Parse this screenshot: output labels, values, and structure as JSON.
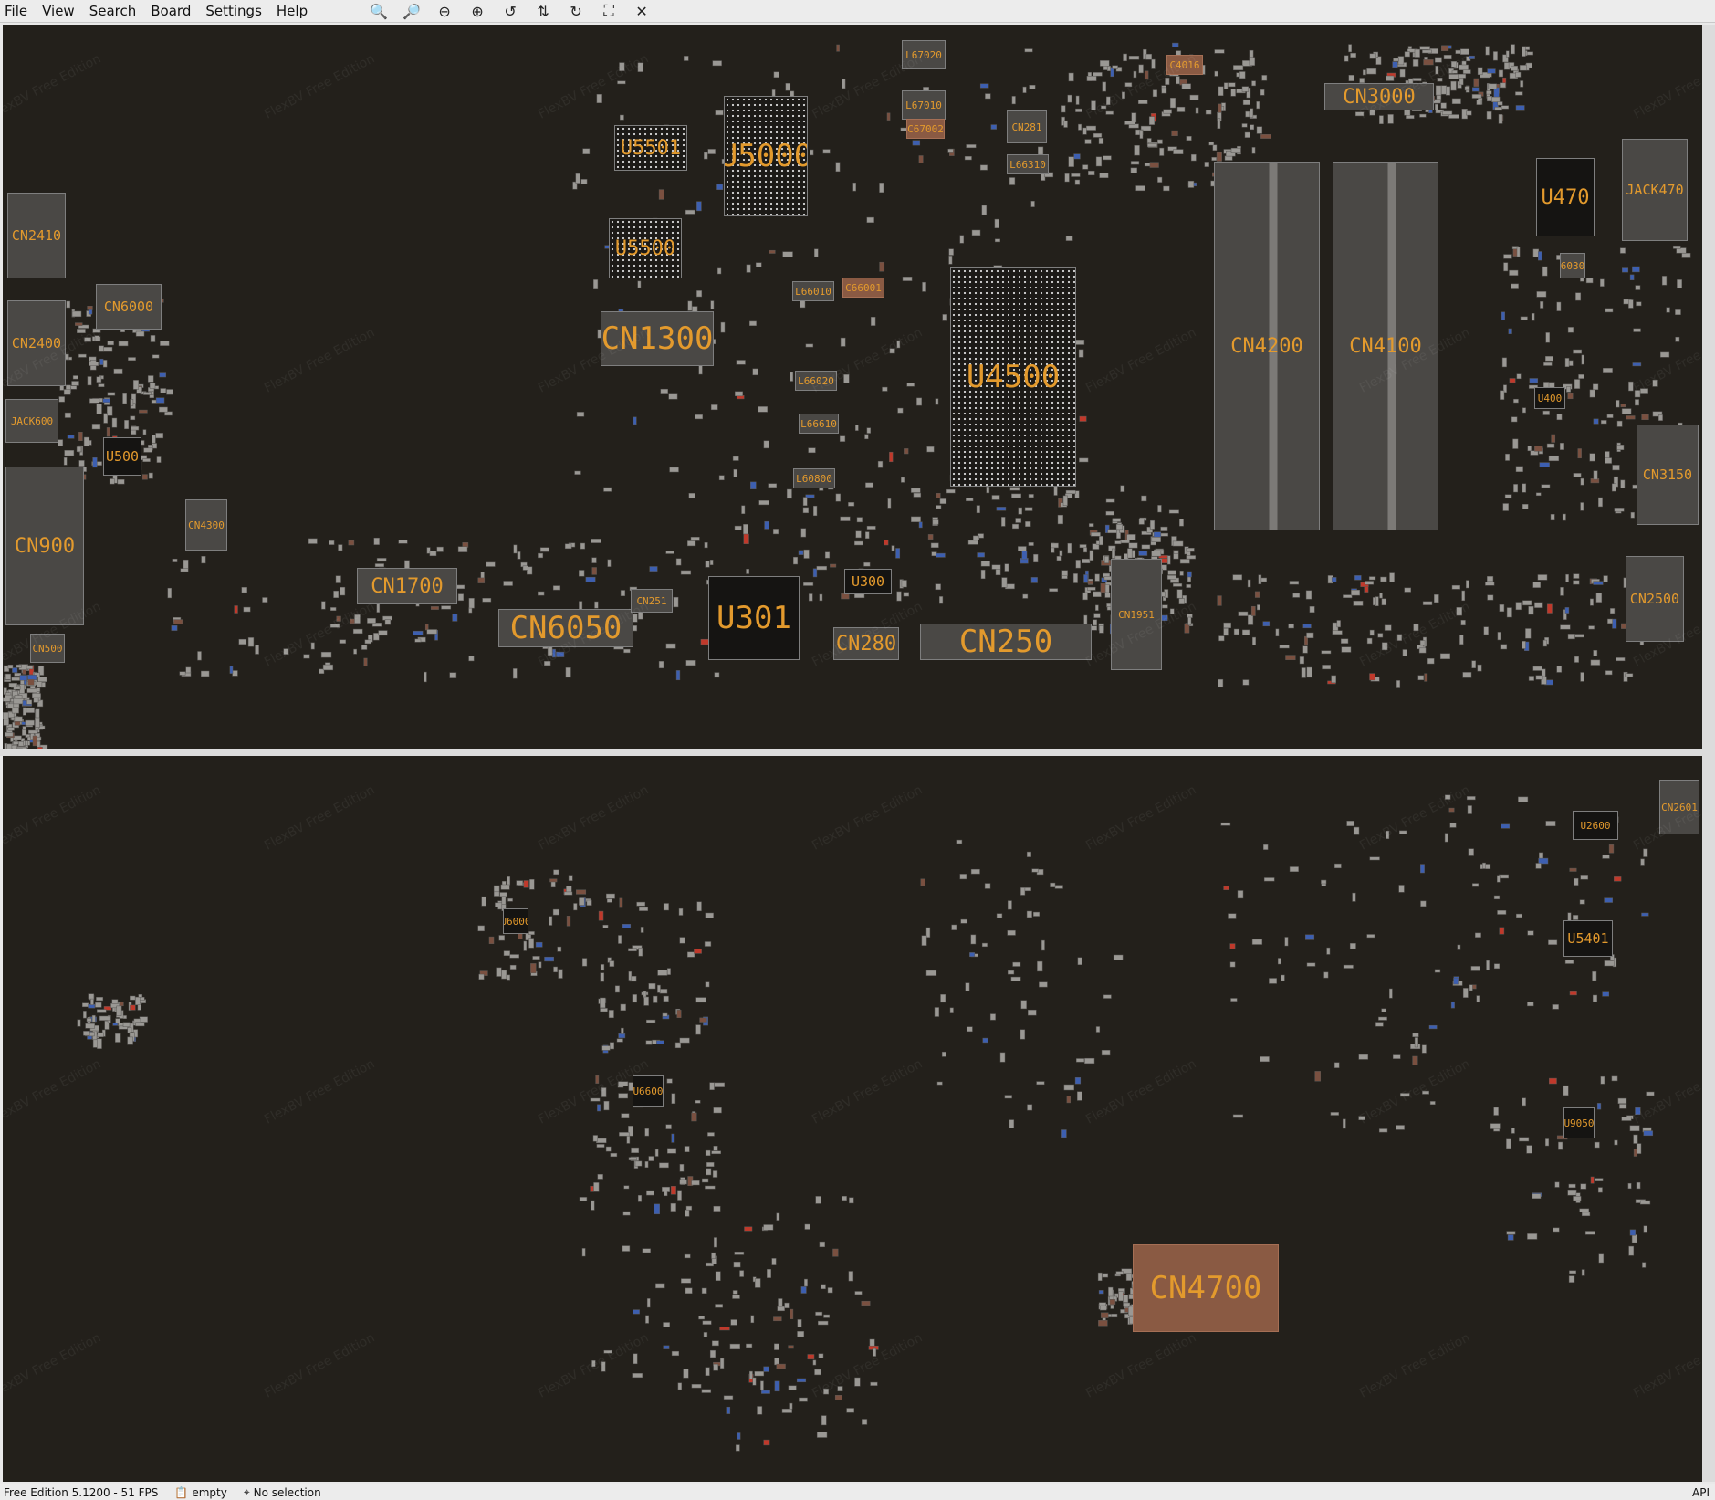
{
  "menu": [
    "File",
    "View",
    "Search",
    "Board",
    "Settings",
    "Help"
  ],
  "toolbar": [
    {
      "name": "zoom-in-icon",
      "glyph": "🔍"
    },
    {
      "name": "zoom-out-icon",
      "glyph": "🔎"
    },
    {
      "name": "zoom-minus-icon",
      "glyph": "⊖"
    },
    {
      "name": "zoom-plus-icon",
      "glyph": "⊕"
    },
    {
      "name": "rotate-left-icon",
      "glyph": "↺"
    },
    {
      "name": "flip-icon",
      "glyph": "⇅"
    },
    {
      "name": "rotate-right-icon",
      "glyph": "↻"
    },
    {
      "name": "fit-view-icon",
      "glyph": "⛶"
    },
    {
      "name": "close-icon",
      "glyph": "✕"
    }
  ],
  "watermark": "FlexBV Free Edition",
  "top_components": [
    {
      "label": "U5000",
      "style": "dotted",
      "size": "lg"
    },
    {
      "label": "U5501",
      "style": "dotted",
      "size": "md"
    },
    {
      "label": "U5500",
      "style": "dotted",
      "size": "md"
    },
    {
      "label": "CN1300",
      "style": "",
      "size": "lg"
    },
    {
      "label": "U4500",
      "style": "dotted",
      "size": "lg"
    },
    {
      "label": "CN4200",
      "style": "dimm",
      "size": "md"
    },
    {
      "label": "CN4100",
      "style": "dimm",
      "size": "md"
    },
    {
      "label": "CN3000",
      "style": "",
      "size": "md"
    },
    {
      "label": "U470",
      "style": "dark",
      "size": "md"
    },
    {
      "label": "JACK470",
      "style": "",
      "size": "sm"
    },
    {
      "label": "CN3150",
      "style": "",
      "size": "sm"
    },
    {
      "label": "CN2500",
      "style": "",
      "size": "sm"
    },
    {
      "label": "CN2410",
      "style": "",
      "size": "sm"
    },
    {
      "label": "CN2400",
      "style": "",
      "size": "sm"
    },
    {
      "label": "CN6000",
      "style": "",
      "size": "sm"
    },
    {
      "label": "JACK600",
      "style": "",
      "size": "xs"
    },
    {
      "label": "U500",
      "style": "dark",
      "size": "sm"
    },
    {
      "label": "CN900",
      "style": "",
      "size": "md"
    },
    {
      "label": "CN4300",
      "style": "",
      "size": "xs"
    },
    {
      "label": "CN500",
      "style": "",
      "size": "xs"
    },
    {
      "label": "CN1700",
      "style": "",
      "size": "md"
    },
    {
      "label": "CN6050",
      "style": "",
      "size": "lg"
    },
    {
      "label": "CN251",
      "style": "",
      "size": "xs"
    },
    {
      "label": "U301",
      "style": "dark",
      "size": "lg"
    },
    {
      "label": "U300",
      "style": "dark",
      "size": "sm"
    },
    {
      "label": "CN280",
      "style": "",
      "size": "md"
    },
    {
      "label": "CN250",
      "style": "",
      "size": "lg"
    },
    {
      "label": "CN1951",
      "style": "",
      "size": "xs"
    },
    {
      "label": "CN281",
      "style": "",
      "size": "xs"
    },
    {
      "label": "L67020",
      "style": "",
      "size": "xs"
    },
    {
      "label": "L67010",
      "style": "",
      "size": "xs"
    },
    {
      "label": "C67002",
      "style": "copper",
      "size": "xs"
    },
    {
      "label": "L66010",
      "style": "",
      "size": "xs"
    },
    {
      "label": "C66001",
      "style": "copper",
      "size": "xs"
    },
    {
      "label": "L66020",
      "style": "",
      "size": "xs"
    },
    {
      "label": "L66610",
      "style": "",
      "size": "xs"
    },
    {
      "label": "L60800",
      "style": "",
      "size": "xs"
    },
    {
      "label": "L66310",
      "style": "",
      "size": "xs"
    },
    {
      "label": "C4016",
      "style": "copper",
      "size": "xs"
    },
    {
      "label": "L60300",
      "style": "",
      "size": "xs"
    },
    {
      "label": "U400",
      "style": "dark",
      "size": "xs"
    },
    {
      "label": "U3200",
      "style": "dark",
      "size": "xs"
    }
  ],
  "bottom_components": [
    {
      "label": "CN4700",
      "style": "copper",
      "size": "lg"
    },
    {
      "label": "U2600",
      "style": "dark",
      "size": "xs"
    },
    {
      "label": "U5401",
      "style": "dark",
      "size": "sm"
    },
    {
      "label": "CN2601",
      "style": "",
      "size": "xs"
    },
    {
      "label": "U6000",
      "style": "dark",
      "size": "xs"
    },
    {
      "label": "U6600",
      "style": "dark",
      "size": "xs"
    },
    {
      "label": "U9050",
      "style": "dark",
      "size": "xs"
    }
  ],
  "status": {
    "left": "Free Edition  5.1200 - 51 FPS",
    "clipboard": "empty",
    "selection": "No selection",
    "right": "API"
  }
}
